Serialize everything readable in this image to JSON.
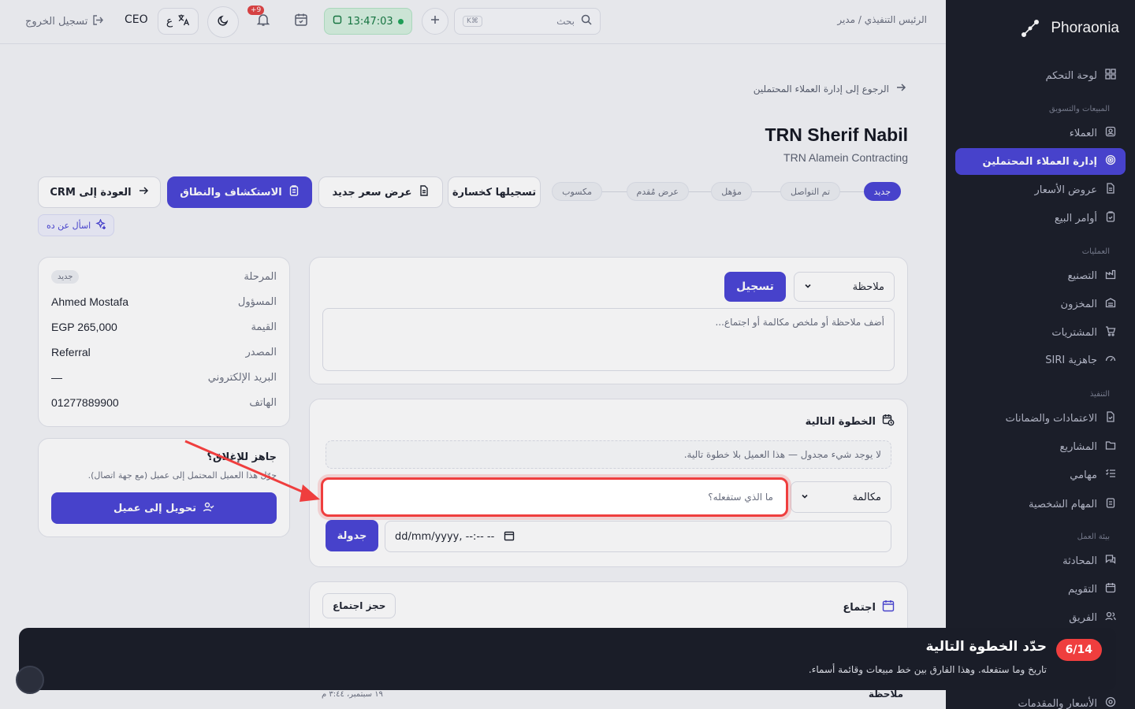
{
  "sidebar": {
    "brand": "Phoraonia",
    "items": [
      {
        "label": "لوحة التحكم"
      },
      {
        "label": "العملاء"
      },
      {
        "label": "إدارة العملاء المحتملين"
      },
      {
        "label": "عروض الأسعار"
      },
      {
        "label": "أوامر البيع"
      },
      {
        "label": "التصنيع"
      },
      {
        "label": "المخزون"
      },
      {
        "label": "المشتريات"
      },
      {
        "label": "جاهزية SIRI"
      },
      {
        "label": "الاعتمادات والضمانات"
      },
      {
        "label": "المشاريع"
      },
      {
        "label": "مهامي"
      },
      {
        "label": "المهام الشخصية"
      },
      {
        "label": "المحادثة"
      },
      {
        "label": "التقويم"
      },
      {
        "label": "الفريق"
      },
      {
        "label": "الأسعار والمقدمات"
      }
    ],
    "sections": [
      "المبيعات والتسويق",
      "العمليات",
      "التنفيذ",
      "بيئة العمل"
    ]
  },
  "topbar": {
    "breadcrumb": "الرئيس التنفيذي / مدير",
    "search_placeholder": "بحث",
    "search_shortcut": "K⌘",
    "clock": "13:47:03",
    "notif_count": "+9",
    "lang_label": "ع",
    "role": "CEO",
    "logout": "تسجيل الخروج"
  },
  "page": {
    "back": "الرجوع إلى إدارة العملاء المحتملين",
    "title": "TRN Sherif Nabil",
    "subtitle": "TRN Alamein Contracting",
    "stages": [
      "جديد",
      "تم التواصل",
      "مؤهل",
      "عرض مُقدم",
      "مكسوب"
    ],
    "actions": {
      "lost": "تسجيلها كخسارة",
      "new_quote": "عرض سعر جديد",
      "discovery": "الاستكشاف والنطاق",
      "back_crm": "العودة إلى CRM"
    },
    "ask_ai": "اسأل عن ده"
  },
  "details": {
    "rows": [
      {
        "k": "المرحلة",
        "v": "جديد"
      },
      {
        "k": "المسؤول",
        "v": "Ahmed Mostafa"
      },
      {
        "k": "القيمة",
        "v": "EGP 265,000"
      },
      {
        "k": "المصدر",
        "v": "Referral"
      },
      {
        "k": "البريد الإلكتروني",
        "v": "—"
      },
      {
        "k": "الهاتف",
        "v": "01277889900"
      }
    ]
  },
  "close_card": {
    "title": "جاهز للإغلاق؟",
    "desc": "حوّل هذا العميل المحتمل إلى عميل (مع جهة اتصال).",
    "button": "تحويل إلى عميل"
  },
  "note": {
    "type": "ملاحظة",
    "submit": "تسجيل",
    "placeholder": "أضف ملاحظة أو ملخص مكالمة أو اجتماع..."
  },
  "next_step": {
    "title": "الخطوة التالية",
    "empty": "لا يوجد شيء مجدول — هذا العميل بلا خطوة تالية.",
    "type": "مكالمة",
    "what_placeholder": "ما الذي ستفعله؟",
    "date_placeholder": "dd/mm/yyyy, --:-- --",
    "schedule": "جدولة"
  },
  "meeting": {
    "title": "اجتماع",
    "book": "حجز اجتماع"
  },
  "activity": {
    "label": "ملاحظة",
    "date": "١٩ سبتمبر، ٣:٤٤ م"
  },
  "tour": {
    "step": "6/14",
    "title": "حدّد الخطوة التالية",
    "desc": "تاريخ وما ستفعله. وهذا الفارق بين خط مبيعات وقائمة أسماء."
  },
  "colors": {
    "accent": "#4b46d6",
    "sidebar": "#1c1f2a",
    "highlight": "#ef3e3e"
  }
}
